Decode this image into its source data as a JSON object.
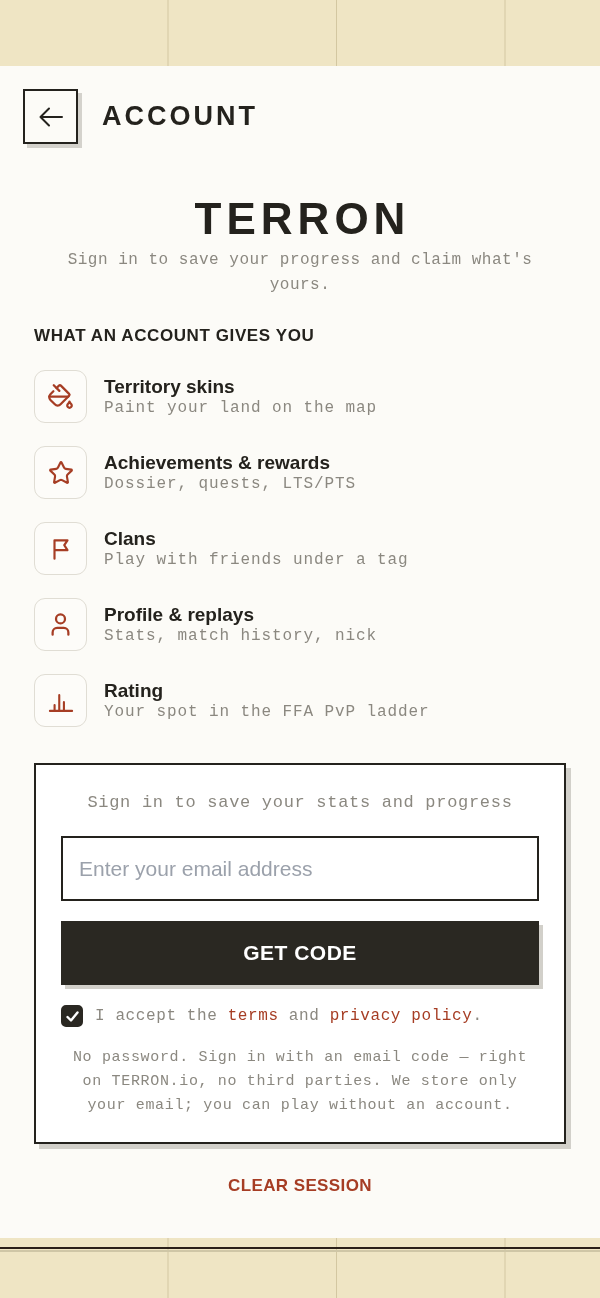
{
  "header": {
    "title": "ACCOUNT"
  },
  "brand": {
    "name": "TERRON",
    "tagline": "Sign in to save your progress and claim what's yours."
  },
  "benefits": {
    "heading": "WHAT AN ACCOUNT GIVES YOU",
    "items": [
      {
        "title": "Territory skins",
        "description": "Paint your land on the map"
      },
      {
        "title": "Achievements & rewards",
        "description": "Dossier, quests, LTS/PTS"
      },
      {
        "title": "Clans",
        "description": "Play with friends under a tag"
      },
      {
        "title": "Profile & replays",
        "description": "Stats, match history, nick"
      },
      {
        "title": "Rating",
        "description": "Your spot in the FFA PvP ladder"
      }
    ]
  },
  "sign_in": {
    "prompt": "Sign in to save your stats and progress",
    "email": {
      "placeholder": "Enter your email address"
    },
    "submit": "GET CODE",
    "consent": {
      "checked": true,
      "segments": [
        {
          "kind": "text",
          "text": "I accept the "
        },
        {
          "kind": "link",
          "text": "terms"
        },
        {
          "kind": "text",
          "text": " and "
        },
        {
          "kind": "link",
          "text": "privacy policy"
        },
        {
          "kind": "text",
          "text": "."
        }
      ]
    },
    "note": "No password. Sign in with an email code — right on TERRON.io, no third parties. We store only your email; you can play without an account."
  },
  "clear_session": "CLEAR SESSION"
}
